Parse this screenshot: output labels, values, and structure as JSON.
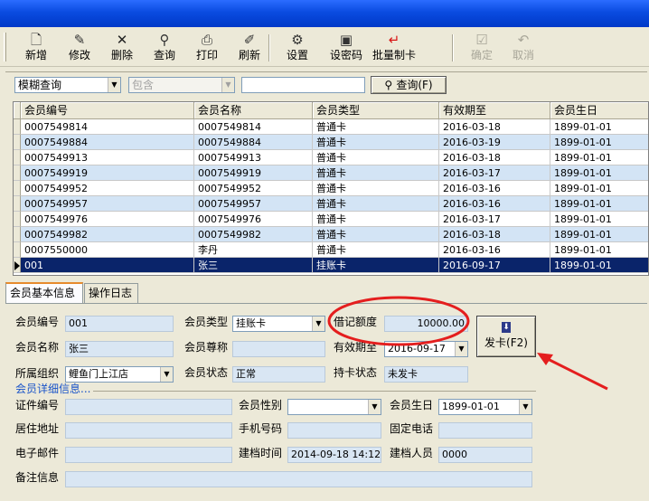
{
  "toolbar": {
    "buttons": [
      {
        "label": "新增",
        "icon": "new-record-icon",
        "glyph": "🗋",
        "enabled": true
      },
      {
        "label": "修改",
        "icon": "eraser-edit-icon",
        "glyph": "✎",
        "enabled": true
      },
      {
        "label": "删除",
        "icon": "delete-x-icon",
        "glyph": "✕",
        "enabled": true
      },
      {
        "label": "查询",
        "icon": "binoculars-icon",
        "glyph": "⚲",
        "enabled": true
      },
      {
        "label": "打印",
        "icon": "printer-icon",
        "glyph": "⎙",
        "enabled": true
      },
      {
        "label": "刷新",
        "icon": "brush-refresh-icon",
        "glyph": "✐",
        "enabled": true
      },
      {
        "label": "设置",
        "icon": "settings-tools-icon",
        "glyph": "⚙",
        "enabled": true
      },
      {
        "label": "设密码",
        "icon": "password-card-icon",
        "glyph": "▣",
        "enabled": true
      },
      {
        "label": "批量制卡",
        "icon": "red-arrow-icon",
        "glyph": "↵",
        "enabled": true
      },
      {
        "label": "确定",
        "icon": "confirm-icon",
        "glyph": "☑",
        "enabled": false
      },
      {
        "label": "取消",
        "icon": "undo-cancel-icon",
        "glyph": "↶",
        "enabled": false
      }
    ]
  },
  "search": {
    "mode": "模糊查询",
    "match": "包含",
    "keyword": "",
    "button_label": "查询(F)"
  },
  "grid": {
    "columns": [
      "会员编号",
      "会员名称",
      "会员类型",
      "有效期至",
      "会员生日"
    ],
    "rows": [
      [
        "0007549814",
        "0007549814",
        "普通卡",
        "2016-03-18",
        "1899-01-01"
      ],
      [
        "0007549884",
        "0007549884",
        "普通卡",
        "2016-03-19",
        "1899-01-01"
      ],
      [
        "0007549913",
        "0007549913",
        "普通卡",
        "2016-03-18",
        "1899-01-01"
      ],
      [
        "0007549919",
        "0007549919",
        "普通卡",
        "2016-03-17",
        "1899-01-01"
      ],
      [
        "0007549952",
        "0007549952",
        "普通卡",
        "2016-03-16",
        "1899-01-01"
      ],
      [
        "0007549957",
        "0007549957",
        "普通卡",
        "2016-03-16",
        "1899-01-01"
      ],
      [
        "0007549976",
        "0007549976",
        "普通卡",
        "2016-03-17",
        "1899-01-01"
      ],
      [
        "0007549982",
        "0007549982",
        "普通卡",
        "2016-03-18",
        "1899-01-01"
      ],
      [
        "0007550000",
        "李丹",
        "普通卡",
        "2016-03-16",
        "1899-01-01"
      ],
      [
        "001",
        "张三",
        "挂账卡",
        "2016-09-17",
        "1899-01-01"
      ]
    ],
    "selected_row": 9
  },
  "tabs": [
    "会员基本信息",
    "操作日志"
  ],
  "form": {
    "member_no_label": "会员编号",
    "member_no": "001",
    "member_type_label": "会员类型",
    "member_type": "挂账卡",
    "credit_label": "借记额度",
    "credit": "10000.00",
    "member_name_label": "会员名称",
    "member_name": "张三",
    "title_label": "会员尊称",
    "title": "",
    "expiry_label": "有效期至",
    "expiry": "2016-09-17",
    "org_label": "所属组织",
    "org": "鲤鱼门上江店",
    "status_label": "会员状态",
    "status": "正常",
    "card_status_label": "持卡状态",
    "card_status": "未发卡",
    "issue_button": "发卡(F2)",
    "detail_group": "会员详细信息...",
    "id_no_label": "证件编号",
    "id_no": "",
    "gender_label": "会员性别",
    "gender": "",
    "birthday_label": "会员生日",
    "birthday": "1899-01-01",
    "address_label": "居住地址",
    "address": "",
    "mobile_label": "手机号码",
    "mobile": "",
    "phone_label": "固定电话",
    "phone": "",
    "email_label": "电子邮件",
    "email": "",
    "created_time_label": "建档时间",
    "created_time": "2014-09-18 14:12",
    "creator_label": "建档人员",
    "creator": "0000",
    "remark_label": "备注信息",
    "remark": ""
  },
  "annotation_color": "#e41e1e"
}
